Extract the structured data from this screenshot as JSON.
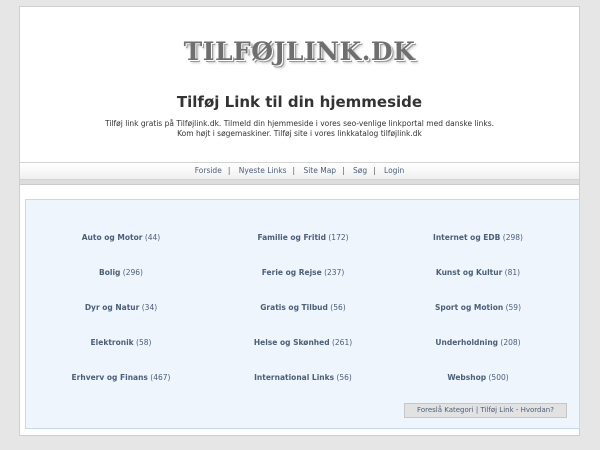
{
  "header": {
    "logo_text": "TILFØJLINK.DK",
    "title": "Tilføj Link til din hjemmeside",
    "intro_line1": "Tilføj link gratis på Tilføjlink.dk. Tilmeld din hjemmeside i vores seo-venlige linkportal med danske links.",
    "intro_line2": "Kom højt i søgemaskiner. Tilføj site i vores linkkatalog tilføjlink.dk"
  },
  "nav": {
    "items": [
      "Forside",
      "Nyeste Links",
      "Site Map",
      "Søg",
      "Login"
    ],
    "separator": "|"
  },
  "categories": [
    {
      "name": "Auto og Motor",
      "count": "(44)"
    },
    {
      "name": "Familie og Fritid",
      "count": "(172)"
    },
    {
      "name": "Internet og EDB",
      "count": "(298)"
    },
    {
      "name": "Bolig",
      "count": "(296)"
    },
    {
      "name": "Ferie og Rejse",
      "count": "(237)"
    },
    {
      "name": "Kunst og Kultur",
      "count": "(81)"
    },
    {
      "name": "Dyr og Natur",
      "count": "(34)"
    },
    {
      "name": "Gratis og Tilbud",
      "count": "(56)"
    },
    {
      "name": "Sport og Motion",
      "count": "(59)"
    },
    {
      "name": "Elektronik",
      "count": "(58)"
    },
    {
      "name": "Helse og Skønhed",
      "count": "(261)"
    },
    {
      "name": "Underholdning",
      "count": "(208)"
    },
    {
      "name": "Erhverv og Finans",
      "count": "(467)"
    },
    {
      "name": "International Links",
      "count": "(56)"
    },
    {
      "name": "Webshop",
      "count": "(500)"
    }
  ],
  "footer_box": {
    "suggest_label": "Foreslå Kategori",
    "separator": "|",
    "howto_label": "Tilføj Link - Hvordan?"
  },
  "colors": {
    "link": "#4a5f78",
    "category_panel": "#eef5fd",
    "page_background": "#e6e6e6"
  }
}
